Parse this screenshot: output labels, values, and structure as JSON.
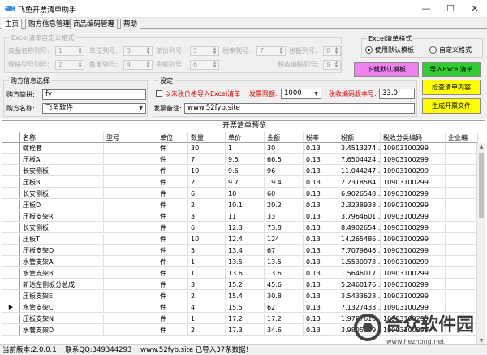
{
  "window": {
    "title": "飞鱼开票清单助手",
    "controls": {
      "minimize": "—",
      "maximize": "☐",
      "close": "✕"
    }
  },
  "tabs": [
    "主页",
    "购方信息管理",
    "商品编码管理",
    "帮助"
  ],
  "format_group": {
    "title": "Excel清单自定义格式",
    "fields": [
      {
        "label": "商品名称列号:",
        "value": "1"
      },
      {
        "label": "单位列号:",
        "value": "3"
      },
      {
        "label": "单价列号:",
        "value": "5"
      },
      {
        "label": "税率列号:",
        "value": "7"
      },
      {
        "label": "税额列号:",
        "value": "8"
      },
      {
        "label": "规格型号列号:",
        "value": "2"
      },
      {
        "label": "数量列号:",
        "value": "4"
      },
      {
        "label": "金额列号:",
        "value": "6"
      },
      {
        "label": "税收编码列号:",
        "value": "9"
      }
    ]
  },
  "template_group": {
    "title": "Excel清单格式",
    "options": [
      "使用默认模板",
      "自定义格式"
    ],
    "selected": 0
  },
  "buttons": {
    "download_template": "下载默认模板",
    "import_excel": "导入Excel清单",
    "check_content": "检查清单内容",
    "generate_file": "生成开票文件"
  },
  "buyer_group": {
    "title": "购方信息选择",
    "short_label": "购方简拼:",
    "short_value": "fy",
    "name_label": "购方名称:",
    "name_value": "飞鱼软件"
  },
  "settings_group": {
    "title": "设定",
    "import_unpriced": "以未税价格导入Excel清单",
    "limit_label": "发票限额:",
    "limit_value": "1000",
    "version_label": "税收编码版本号:",
    "version_value": "33.0",
    "remark_label": "发票备注:",
    "remark_value": "www.52fyb.site"
  },
  "table": {
    "caption": "开票清单预览",
    "columns": [
      "名称",
      "型号",
      "单位",
      "数量",
      "单价",
      "金额",
      "税率",
      "税额",
      "税收分类编码",
      "企业编"
    ],
    "rows": [
      [
        "螺栓套",
        "",
        "件",
        "30",
        "1",
        "30",
        "0.13",
        "3.4513274...",
        "10903100299",
        ""
      ],
      [
        "压板A",
        "",
        "件",
        "7",
        "9.5",
        "66.5",
        "0.13",
        "7.6504424...",
        "10903100299",
        ""
      ],
      [
        "长安侧板",
        "",
        "件",
        "10",
        "9.6",
        "96",
        "0.13",
        "11.044247...",
        "10903100299",
        ""
      ],
      [
        "压板B",
        "",
        "件",
        "2",
        "9.7",
        "19.4",
        "0.13",
        "2.2318584...",
        "10903100299",
        ""
      ],
      [
        "长安侧板",
        "",
        "件",
        "6",
        "10",
        "60",
        "0.13",
        "6.9026548...",
        "10903100299",
        ""
      ],
      [
        "压板D",
        "",
        "件",
        "2",
        "10.1",
        "20.2",
        "0.13",
        "2.3238938...",
        "10903100299",
        ""
      ],
      [
        "压板支架R",
        "",
        "件",
        "3",
        "11",
        "33",
        "0.13",
        "3.7964601...",
        "10903100299",
        ""
      ],
      [
        "长安侧板",
        "",
        "件",
        "6",
        "12.3",
        "73.8",
        "0.13",
        "8.4902654...",
        "10903100299",
        ""
      ],
      [
        "压板T",
        "",
        "件",
        "10",
        "12.4",
        "124",
        "0.13",
        "14.265486...",
        "10903100299",
        ""
      ],
      [
        "压板支架D",
        "",
        "件",
        "5",
        "13.4",
        "67",
        "0.13",
        "7.7079646...",
        "10903100299",
        ""
      ],
      [
        "水管支架A",
        "",
        "件",
        "1",
        "13.5",
        "13.5",
        "0.13",
        "1.5530973...",
        "10903100299",
        ""
      ],
      [
        "水管支架B",
        "",
        "件",
        "1",
        "13.6",
        "13.6",
        "0.13",
        "1.5646017...",
        "10903100299",
        ""
      ],
      [
        "新达左侧板分总成",
        "",
        "件",
        "3",
        "15.2",
        "45.6",
        "0.13",
        "5.2460176...",
        "10903100299",
        ""
      ],
      [
        "压板支架E",
        "",
        "件",
        "2",
        "15.4",
        "30.8",
        "0.13",
        "3.5433628...",
        "10903100299",
        ""
      ],
      [
        "水管支架C",
        "",
        "件",
        "4",
        "15.5",
        "62",
        "0.13",
        "7.1327433...",
        "10903100299",
        ""
      ],
      [
        "压板支架N",
        "",
        "件",
        "1",
        "17.2",
        "17.2",
        "0.13",
        "1.9787610...",
        "10903100299",
        ""
      ],
      [
        "水管支架D",
        "",
        "件",
        "2",
        "17.3",
        "34.6",
        "0.13",
        "3.9805309...",
        "10903100299",
        ""
      ]
    ],
    "current_row": 14
  },
  "status": {
    "version": "当前版本:2.0.0.1",
    "qq": "联系QQ:349344293",
    "site": "www.52fyb.site",
    "message": "已导入37条数据!"
  },
  "watermark": {
    "title": "合众软件园",
    "url": "www.hezhong.net"
  },
  "colors": {
    "download_btn": "#ee82ee",
    "import_btn": "#32cd32",
    "check_btn": "#ffff00",
    "generate_btn": "#ffff00",
    "settings_link": "#d40000"
  }
}
